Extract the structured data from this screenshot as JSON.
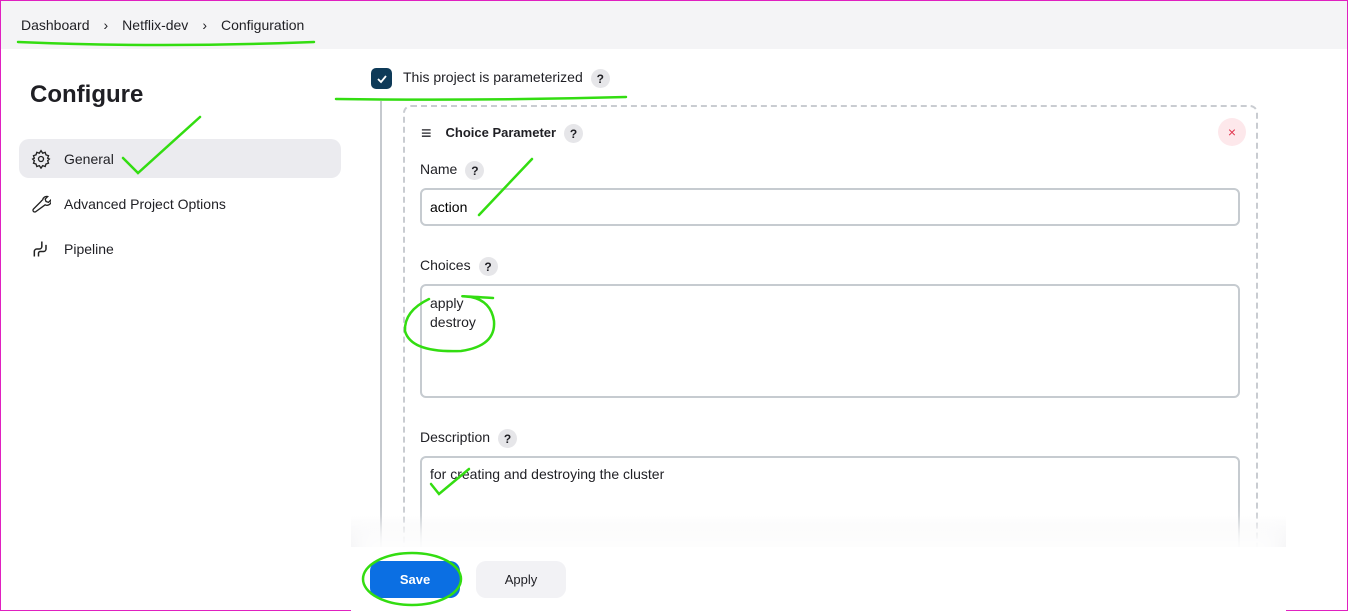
{
  "breadcrumb": [
    "Dashboard",
    "Netflix-dev",
    "Configuration"
  ],
  "sidebar": {
    "title": "Configure",
    "items": [
      {
        "label": "General",
        "icon": "gear-icon"
      },
      {
        "label": "Advanced Project Options",
        "icon": "wrench-icon"
      },
      {
        "label": "Pipeline",
        "icon": "pipeline-icon"
      }
    ]
  },
  "main": {
    "parameterized_label": "This project is parameterized",
    "parameterized_checked": true,
    "help": "?",
    "param": {
      "title": "Choice Parameter",
      "close": "×",
      "name_label": "Name",
      "name_value": "action",
      "choices_label": "Choices",
      "choices": [
        "apply",
        "destroy"
      ],
      "description_label": "Description",
      "description_value": "for creating and destroying the cluster"
    }
  },
  "buttons": {
    "save": "Save",
    "apply": "Apply"
  },
  "colors": {
    "primary": "#0b6fe3",
    "checkbox": "#0e3a58",
    "annotation": "#33dd11"
  }
}
